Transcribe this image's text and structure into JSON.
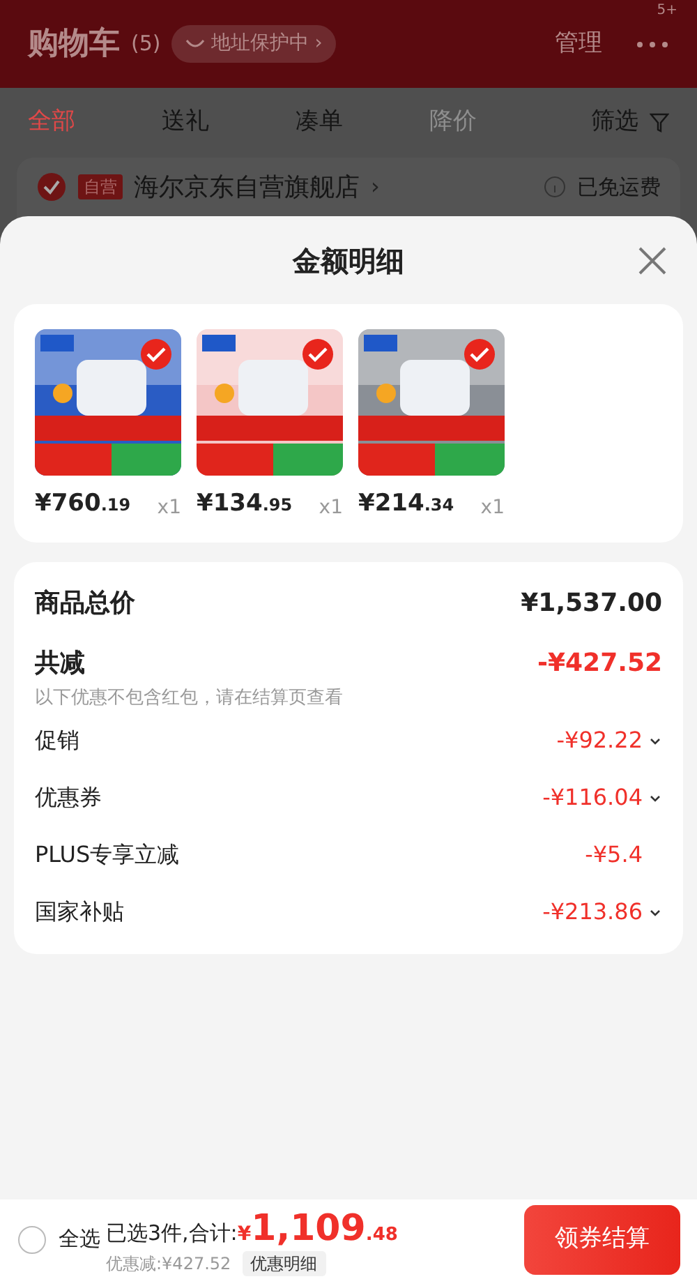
{
  "header": {
    "title": "购物车",
    "count": "(5)",
    "address_pill": "地址保护中 ›",
    "manage": "管理",
    "more_badge": "5+"
  },
  "tabs": [
    {
      "label": "全部",
      "selected": true,
      "disabled": false
    },
    {
      "label": "送礼",
      "selected": false,
      "disabled": false
    },
    {
      "label": "凑单",
      "selected": false,
      "disabled": false
    },
    {
      "label": "降价",
      "selected": false,
      "disabled": true
    }
  ],
  "filter": "筛选",
  "store": {
    "checked": true,
    "tag": "自营",
    "name": "海尔京东自营旗舰店",
    "arrow": "›",
    "shipping": "已免运费"
  },
  "sheet": {
    "title": "金额明细",
    "products": [
      {
        "price": "¥760",
        "cents": ".19",
        "qty": "x1",
        "checked": true
      },
      {
        "price": "¥134",
        "cents": ".95",
        "qty": "x1",
        "checked": true
      },
      {
        "price": "¥214",
        "cents": ".34",
        "qty": "x1",
        "checked": true
      }
    ],
    "total": {
      "label": "商品总价",
      "value": "¥1,537.00"
    },
    "discount": {
      "label": "共减",
      "value": "-¥427.52",
      "note": "以下优惠不包含红包，请在结算页查看"
    },
    "items": [
      {
        "label": "促销",
        "value": "-¥92.22",
        "expandable": true
      },
      {
        "label": "优惠券",
        "value": "-¥116.04",
        "expandable": true
      },
      {
        "label": "PLUS专享立减",
        "value": "-¥5.4",
        "expandable": false
      },
      {
        "label": "国家补贴",
        "value": "-¥213.86",
        "expandable": true
      }
    ]
  },
  "footer": {
    "select_all_checked": false,
    "select_all": "全选",
    "selected_text": "已选3件,合计:",
    "currency": "¥",
    "amount": "1,109",
    "cents": ".48",
    "saved": "优惠减:¥427.52",
    "detail_chip": "优惠明细",
    "checkout": "领券结算"
  }
}
